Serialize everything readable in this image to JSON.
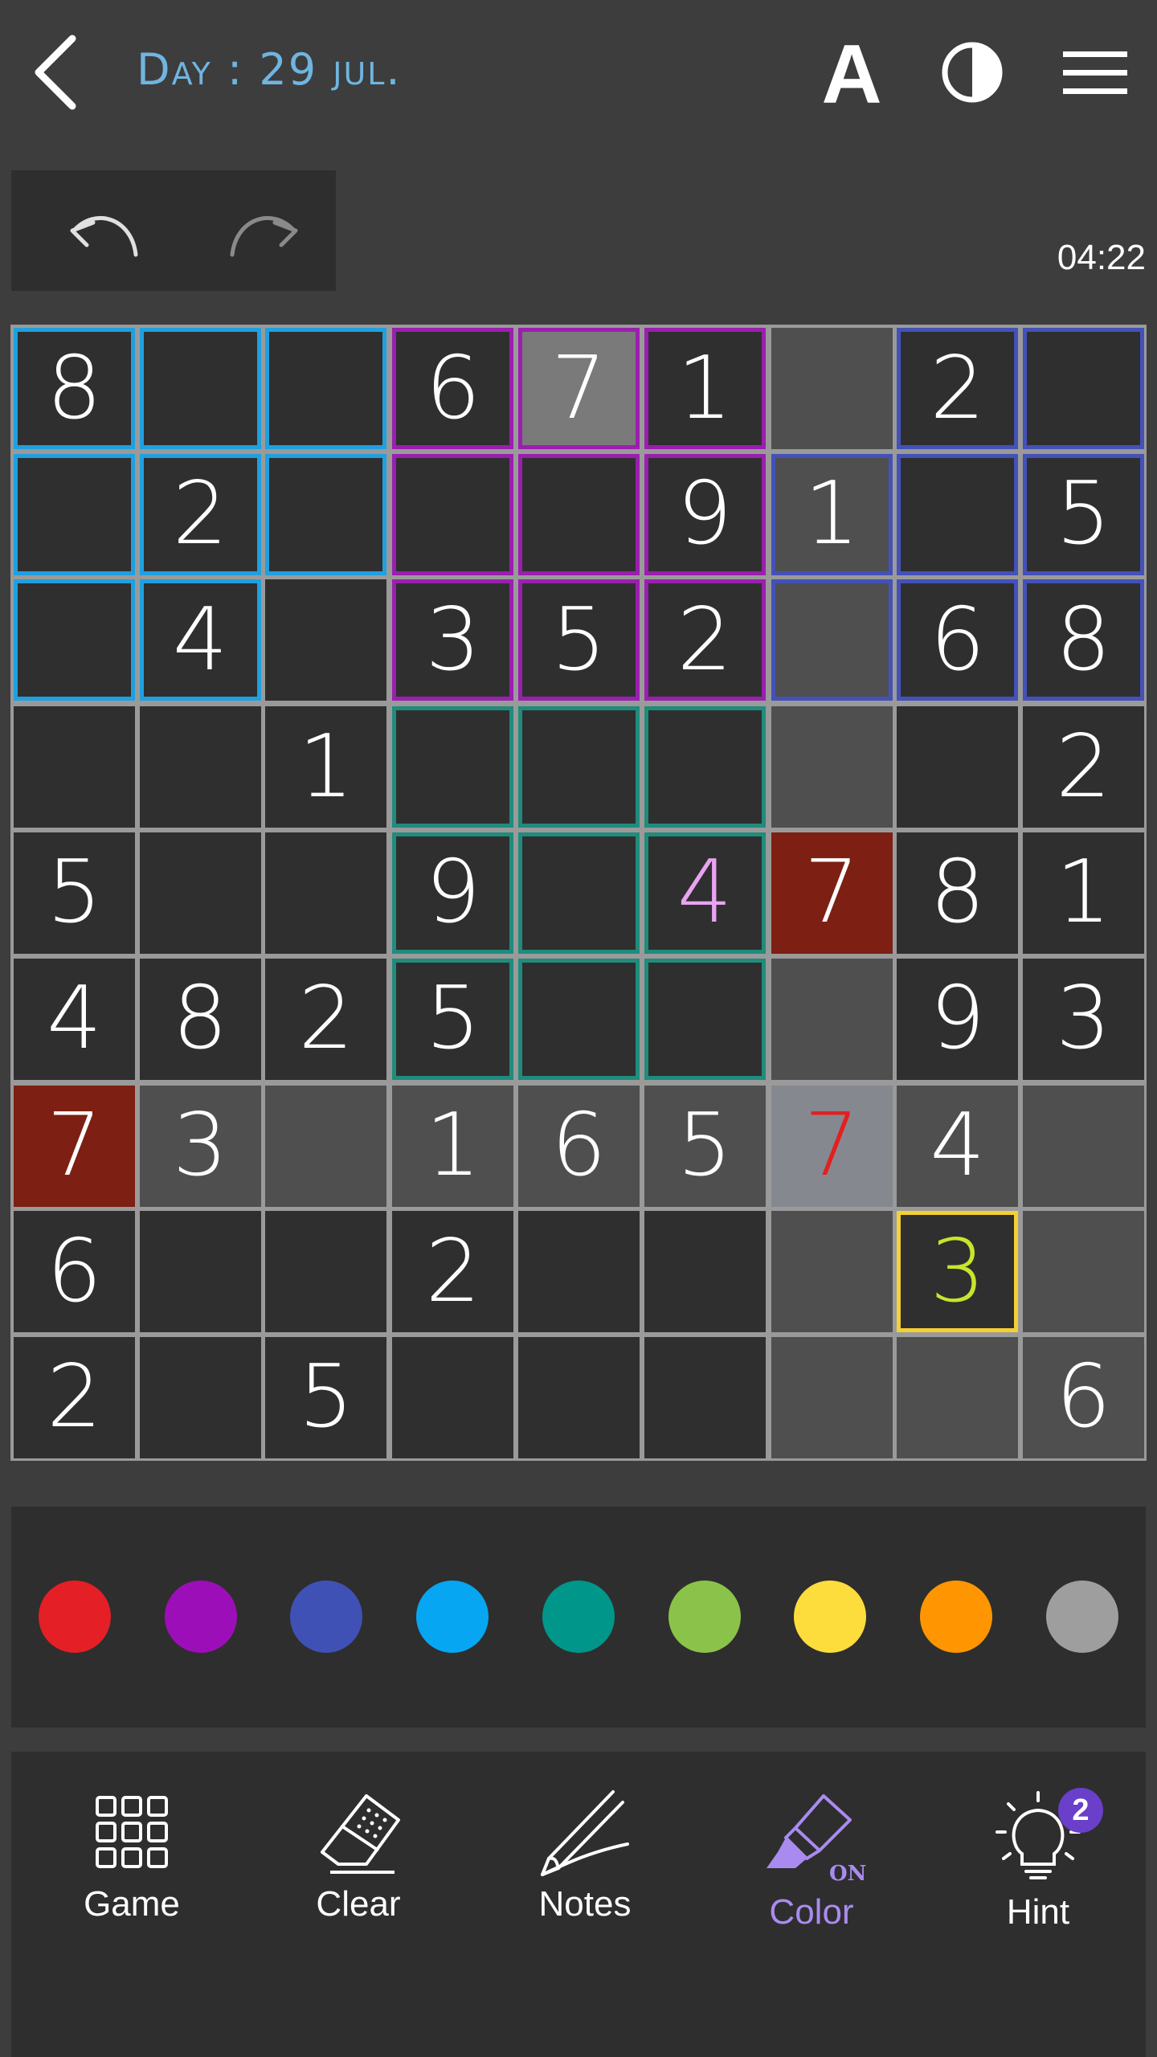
{
  "header": {
    "title": "Day : 29 jul.",
    "back_icon": "chevron-left-icon",
    "font_icon_label": "A",
    "contrast_icon": "contrast-icon",
    "menu_icon": "hamburger-menu-icon"
  },
  "history": {
    "undo_icon": "undo-icon",
    "redo_icon": "redo-icon",
    "timer": "04:22"
  },
  "board": {
    "rows": [
      [
        "8",
        "",
        "",
        "6",
        "7",
        "1",
        "",
        "2",
        ""
      ],
      [
        "",
        "2",
        "",
        "",
        "",
        "9",
        "1",
        "",
        "5"
      ],
      [
        "",
        "4",
        "",
        "3",
        "5",
        "2",
        "",
        "6",
        "8"
      ],
      [
        "",
        "",
        "1",
        "",
        "",
        "",
        "",
        "",
        "2"
      ],
      [
        "5",
        "",
        "",
        "9",
        "",
        "4",
        "7",
        "8",
        "1"
      ],
      [
        "4",
        "8",
        "2",
        "5",
        "",
        "",
        "",
        "9",
        "3"
      ],
      [
        "7",
        "3",
        "",
        "1",
        "6",
        "5",
        "7",
        "4",
        ""
      ],
      [
        "6",
        "",
        "",
        "2",
        "",
        "",
        "",
        "3",
        ""
      ],
      [
        "2",
        "",
        "5",
        "",
        "",
        "",
        "",
        "",
        "6"
      ]
    ],
    "selected_cell": [
      7,
      7
    ],
    "conflict_cells": [
      [
        4,
        6
      ],
      [
        6,
        0
      ]
    ],
    "colors": {
      "cell_bg": "#2f2f2f",
      "cell_shaded": "#4f4f4f",
      "cell_highlight": "#7a7a7a",
      "cell_peer": "#868890",
      "conflict_bg": "#7d1f12",
      "selected_border": "#f5d033",
      "selected_text": "#c6e62c",
      "error_text": "#e41f1f",
      "note_text": "#e9a3f2",
      "box_cyan": "#1fa0e0",
      "box_purple": "#9b1faf",
      "box_indigo": "#4451b8",
      "box_teal": "#1f8c7c"
    }
  },
  "palette": {
    "colors": [
      {
        "name": "red",
        "hex": "#e41f26"
      },
      {
        "name": "purple",
        "hex": "#9c0fb8"
      },
      {
        "name": "indigo",
        "hex": "#4051b5"
      },
      {
        "name": "light-blue",
        "hex": "#06a6f2"
      },
      {
        "name": "teal",
        "hex": "#00968a"
      },
      {
        "name": "light-green",
        "hex": "#8bc34a"
      },
      {
        "name": "yellow",
        "hex": "#fddd3b"
      },
      {
        "name": "orange",
        "hex": "#ff9601"
      },
      {
        "name": "grey",
        "hex": "#9e9e9e"
      }
    ]
  },
  "toolbar": {
    "game_label": "Game",
    "clear_label": "Clear",
    "notes_label": "Notes",
    "color_label": "Color",
    "color_on_badge": "ON",
    "hint_label": "Hint",
    "hint_count": "2",
    "active_tool": "color"
  }
}
